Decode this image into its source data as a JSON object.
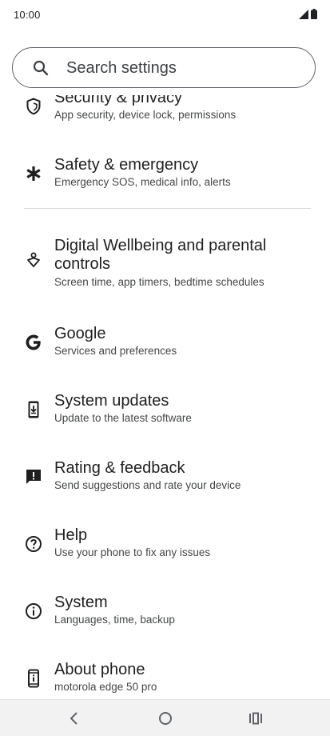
{
  "status_bar": {
    "time": "10:00"
  },
  "search": {
    "placeholder": "Search settings"
  },
  "items": [
    {
      "title": "Security & privacy",
      "summary": "App security, device lock, permissions",
      "icon": "shield-icon"
    },
    {
      "title": "Safety & emergency",
      "summary": "Emergency SOS, medical info, alerts",
      "icon": "asterisk-icon"
    },
    {
      "title": "Digital Wellbeing and parental controls",
      "summary": "Screen time, app timers, bedtime schedules",
      "icon": "wellbeing-icon"
    },
    {
      "title": "Google",
      "summary": "Services and preferences",
      "icon": "google-icon"
    },
    {
      "title": "System updates",
      "summary": "Update to the latest software",
      "icon": "system-update-icon"
    },
    {
      "title": "Rating & feedback",
      "summary": "Send suggestions and rate your device",
      "icon": "feedback-icon"
    },
    {
      "title": "Help",
      "summary": "Use your phone to fix any issues",
      "icon": "help-icon"
    },
    {
      "title": "System",
      "summary": "Languages, time, backup",
      "icon": "info-icon"
    },
    {
      "title": "About phone",
      "summary": "motorola edge 50 pro",
      "icon": "phone-icon"
    }
  ],
  "colors": {
    "text_primary": "#1f1f1f",
    "text_secondary": "#444746",
    "divider": "#d8d8d8",
    "nav_bg": "#f2f2f2"
  }
}
